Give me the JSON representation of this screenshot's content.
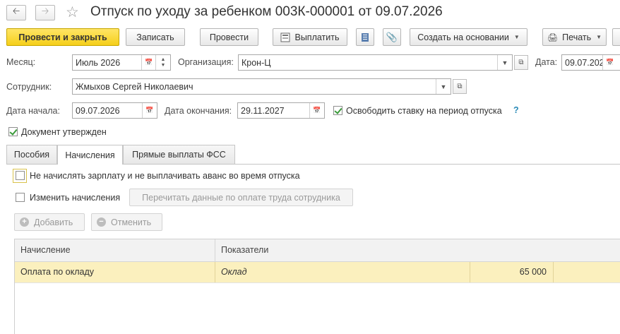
{
  "window": {
    "title": "Отпуск по уходу за ребенком 003К-000001 от 09.07.2026"
  },
  "toolbar": {
    "post_close": "Провести и закрыть",
    "save": "Записать",
    "post": "Провести",
    "pay": "Выплатить",
    "create_based": "Создать на основании",
    "print": "Печать"
  },
  "form": {
    "month_label": "Месяц:",
    "month_value": "Июль 2026",
    "org_label": "Организация:",
    "org_value": "Крон-Ц",
    "date_label": "Дата:",
    "date_value": "09.07.2026",
    "employee_label": "Сотрудник:",
    "employee_value": "Жмыхов Сергей Николаевич",
    "start_label": "Дата начала:",
    "start_value": "09.07.2026",
    "end_label": "Дата окончания:",
    "end_value": "29.11.2027",
    "release_rate_label": "Освободить ставку на период отпуска",
    "help": "?",
    "approved_label": "Документ утвержден"
  },
  "tabs": [
    {
      "label": "Пособия"
    },
    {
      "label": "Начисления"
    },
    {
      "label": "Прямые выплаты ФСС"
    }
  ],
  "accruals": {
    "no_salary_label": "Не начислять зарплату и не выплачивать аванс во время отпуска",
    "change_label": "Изменить начисления",
    "reread_label": "Перечитать данные по оплате труда сотрудника",
    "add_label": "Добавить",
    "cancel_label": "Отменить",
    "columns": [
      "Начисление",
      "Показатели"
    ],
    "rows": [
      {
        "accrual": "Оплата по окладу",
        "indicator": "Оклад",
        "value": "65 000"
      }
    ]
  }
}
